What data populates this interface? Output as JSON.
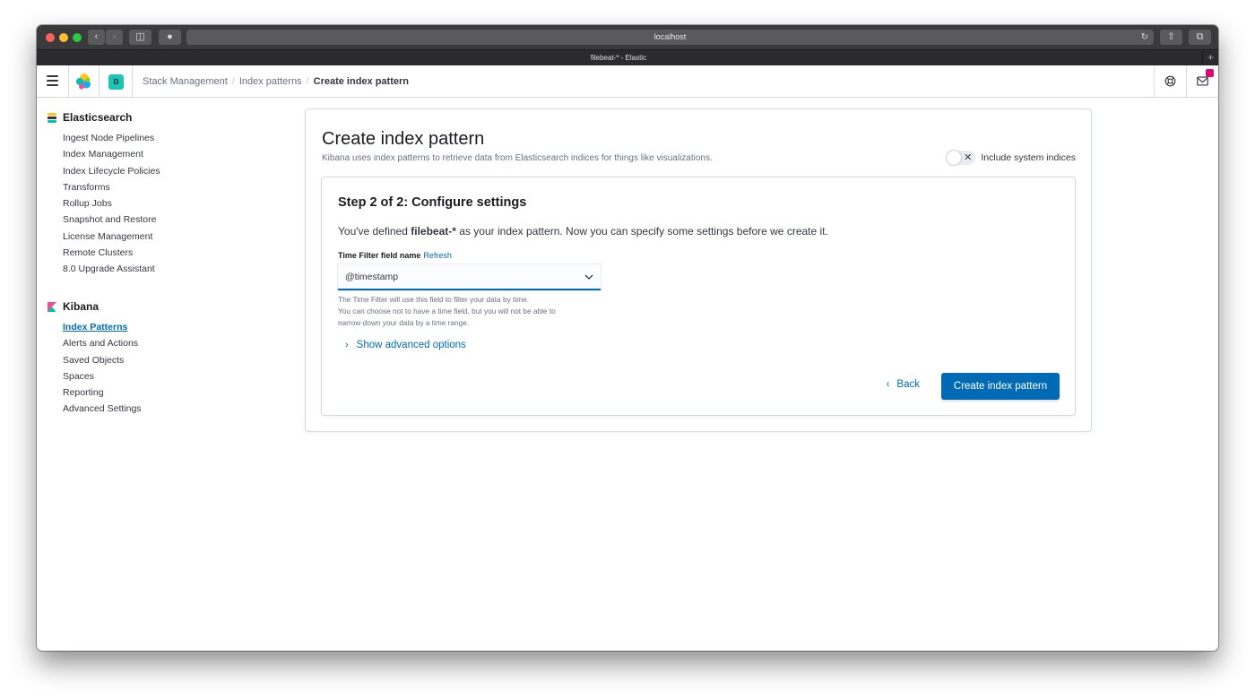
{
  "browser": {
    "url": "localhost",
    "tab_title": "filebeat-* - Elastic",
    "new_tab": "+"
  },
  "header": {
    "space_initial": "D",
    "breadcrumbs": [
      "Stack Management",
      "Index patterns",
      "Create index pattern"
    ]
  },
  "sidebar": {
    "groups": [
      {
        "title": "Elasticsearch",
        "items": [
          "Ingest Node Pipelines",
          "Index Management",
          "Index Lifecycle Policies",
          "Transforms",
          "Rollup Jobs",
          "Snapshot and Restore",
          "License Management",
          "Remote Clusters",
          "8.0 Upgrade Assistant"
        ]
      },
      {
        "title": "Kibana",
        "items": [
          "Index Patterns",
          "Alerts and Actions",
          "Saved Objects",
          "Spaces",
          "Reporting",
          "Advanced Settings"
        ],
        "active_item": "Index Patterns"
      }
    ]
  },
  "main": {
    "title": "Create index pattern",
    "subtitle": "Kibana uses index patterns to retrieve data from Elasticsearch indices for things like visualizations.",
    "system_indices_toggle": {
      "label": "Include system indices",
      "checked": false
    },
    "step": {
      "title": "Step 2 of 2: Configure settings",
      "desc_prefix": "You've defined",
      "pattern": "filebeat-*",
      "desc_suffix": "as your index pattern. Now you can specify some settings before we create it.",
      "field_label": "Time Filter field name",
      "refresh_label": "Refresh",
      "selected_field": "@timestamp",
      "help_lines": [
        "The Time Filter will use this field to filter your data by time.",
        "You can choose not to have a time field, but you will not be able to",
        "narrow down your data by a time range."
      ],
      "advanced_label": "Show advanced options",
      "back_label": "Back",
      "create_label": "Create index pattern"
    }
  },
  "colors": {
    "primary": "#006bb4",
    "space_avatar": "#1ac4b6",
    "news_badge": "#dd0a73"
  },
  "icons": {
    "menu": "hamburger-icon",
    "help": "help-icon",
    "news": "newsfeed-icon"
  }
}
